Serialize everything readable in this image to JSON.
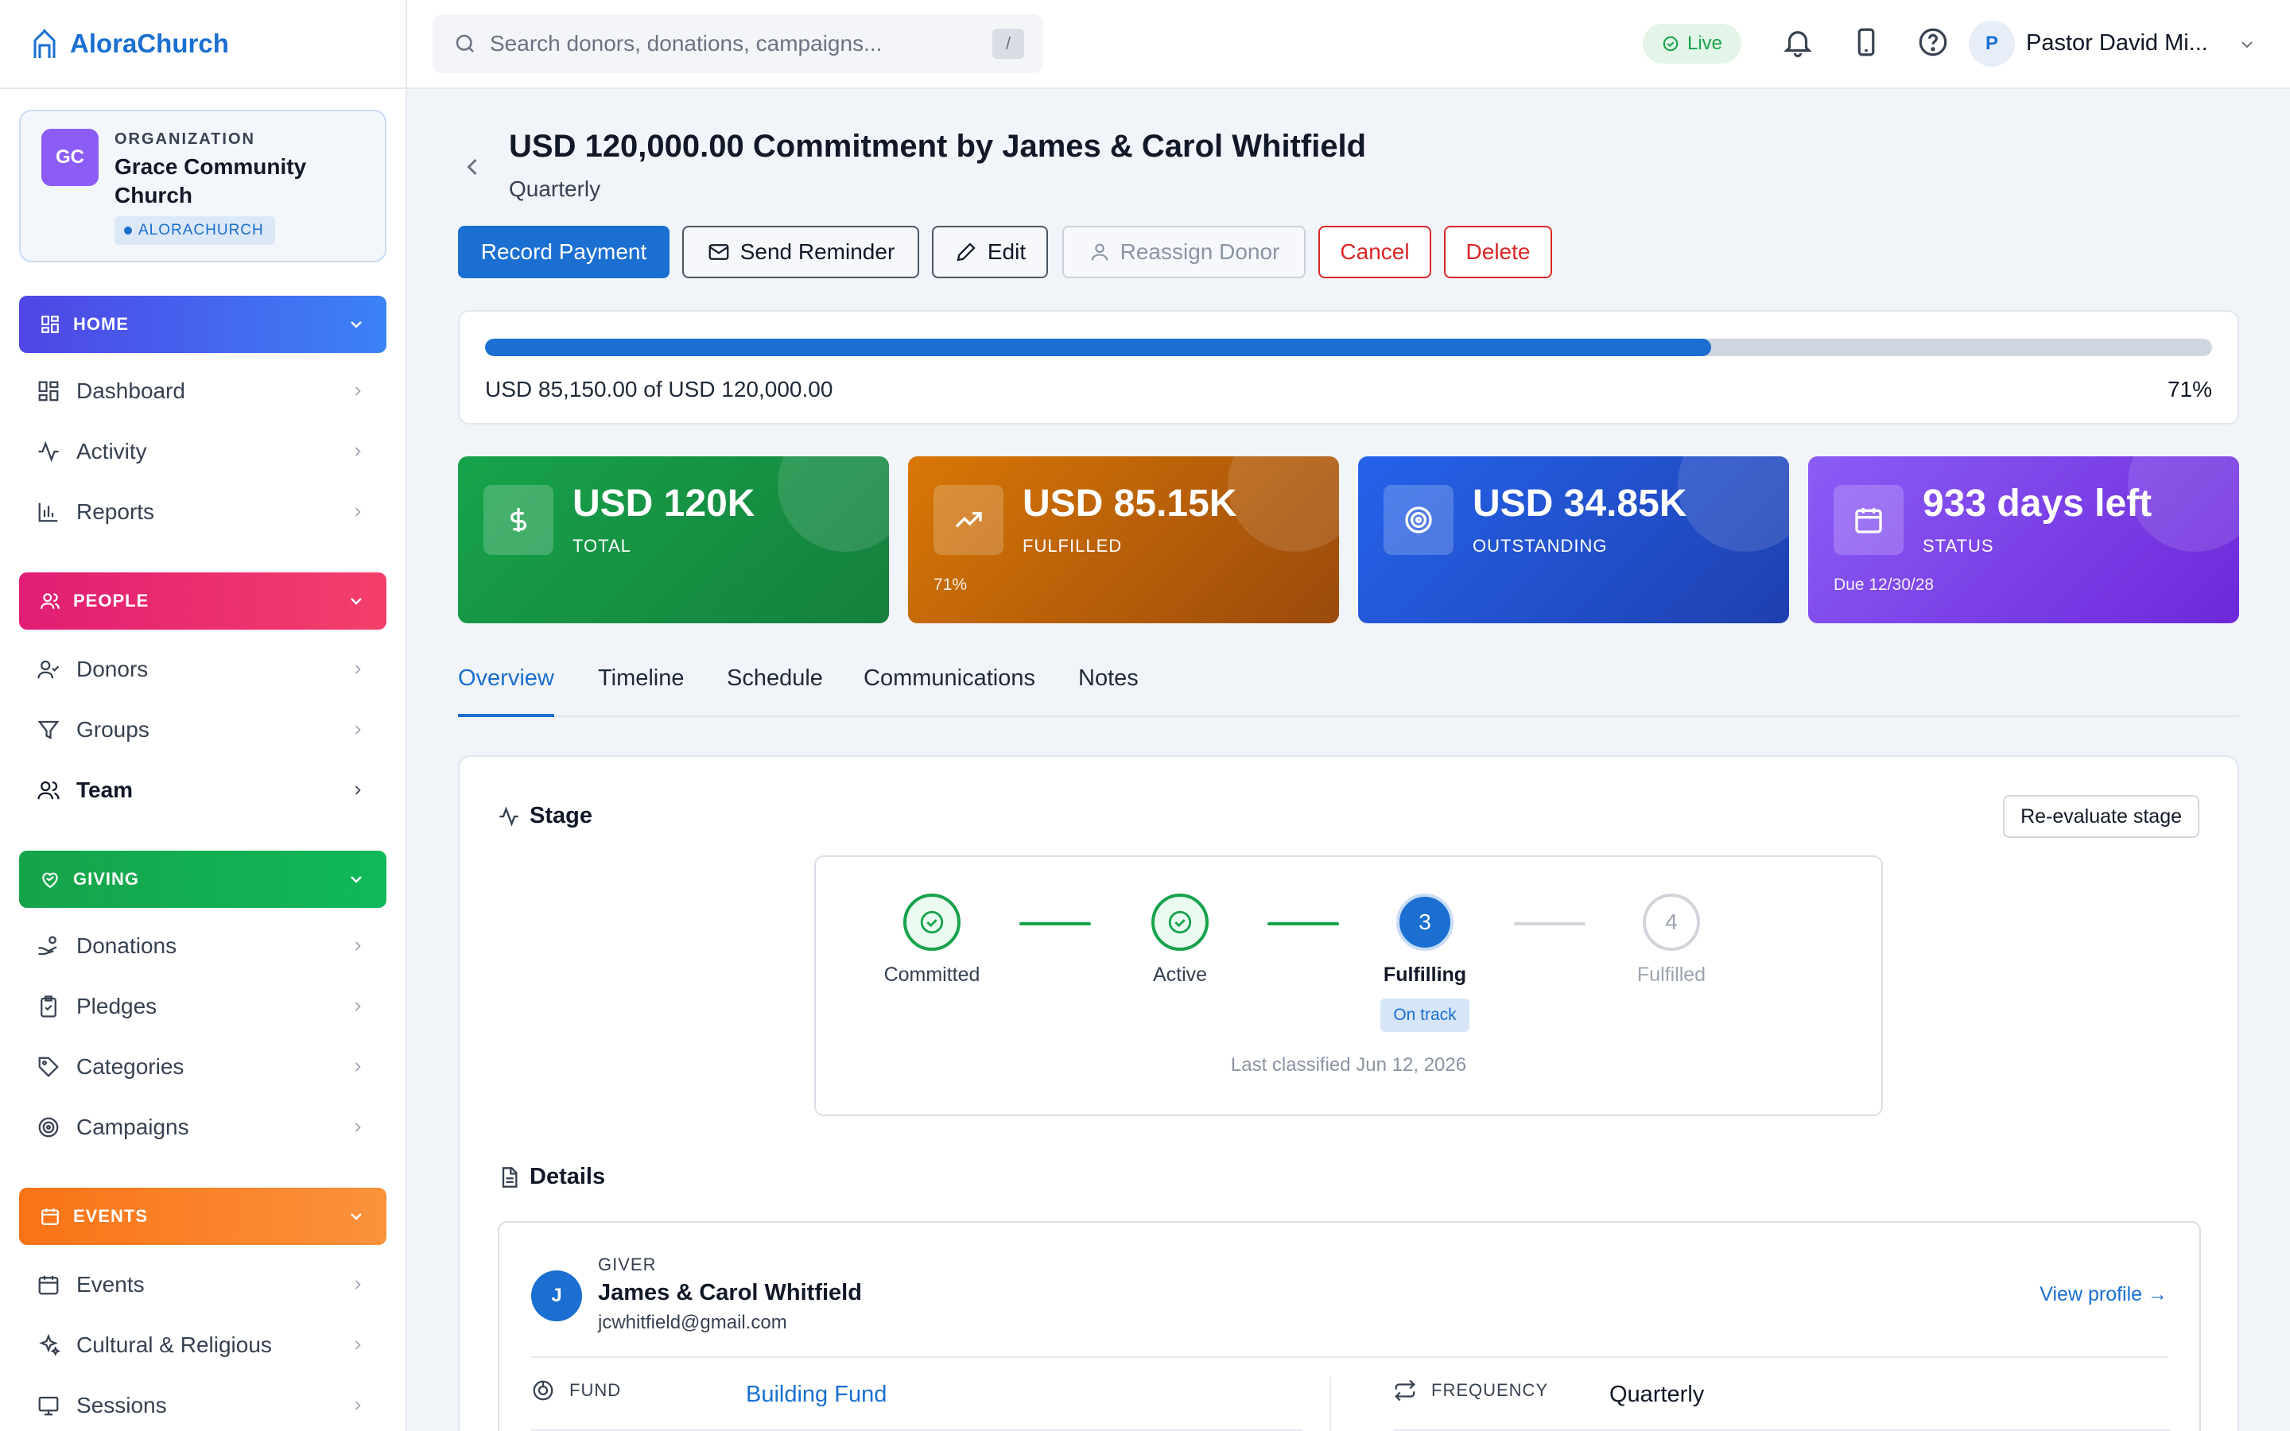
{
  "app": {
    "brand": "AloraChurch"
  },
  "org": {
    "label": "ORGANIZATION",
    "name": "Grace Community Church",
    "initials": "GC",
    "tag": "ALORACHURCH"
  },
  "sidebar": {
    "sections": [
      {
        "label": "HOME",
        "items": [
          "Dashboard",
          "Activity",
          "Reports"
        ]
      },
      {
        "label": "PEOPLE",
        "items": [
          "Donors",
          "Groups",
          "Team"
        ]
      },
      {
        "label": "GIVING",
        "items": [
          "Donations",
          "Pledges",
          "Categories",
          "Campaigns"
        ]
      },
      {
        "label": "EVENTS",
        "items": [
          "Events",
          "Cultural & Religious",
          "Sessions"
        ]
      }
    ],
    "active_item": "Team",
    "colors": {
      "home": "#4f46e5",
      "people": "#e11d74",
      "giving": "#16a34a",
      "events": "#f97316"
    }
  },
  "topbar": {
    "search_placeholder": "Search donors, donations, campaigns...",
    "search_shortcut": "/",
    "live_label": "Live",
    "user_initial": "P",
    "user_name": "Pastor David Mi..."
  },
  "page": {
    "title": "USD 120,000.00 Commitment by James & Carol Whitfield",
    "subtitle": "Quarterly",
    "actions": {
      "record_payment": "Record Payment",
      "send_reminder": "Send Reminder",
      "edit": "Edit",
      "reassign_donor": "Reassign Donor",
      "cancel": "Cancel",
      "delete": "Delete"
    }
  },
  "progress": {
    "text": "USD 85,150.00 of USD 120,000.00",
    "percent_label": "71%",
    "fraction": 0.71
  },
  "stats": [
    {
      "value": "USD 120K",
      "label": "TOTAL",
      "sub": "",
      "icon": "dollar-icon",
      "color": "#15803d"
    },
    {
      "value": "USD 85.15K",
      "label": "FULFILLED",
      "sub": "71%",
      "icon": "trending-up-icon",
      "color": "#c2410c"
    },
    {
      "value": "USD 34.85K",
      "label": "OUTSTANDING",
      "sub": "",
      "icon": "target-icon",
      "color": "#1d4ed8"
    },
    {
      "value": "933 days left",
      "label": "STATUS",
      "sub": "Due 12/30/28",
      "icon": "calendar-icon",
      "color": "#7c3aed"
    }
  ],
  "tabs": [
    "Overview",
    "Timeline",
    "Schedule",
    "Communications",
    "Notes"
  ],
  "active_tab": "Overview",
  "stage": {
    "heading": "Stage",
    "reevaluate": "Re-evaluate stage",
    "steps": [
      {
        "num": "1",
        "label": "Committed",
        "state": "done"
      },
      {
        "num": "2",
        "label": "Active",
        "state": "done"
      },
      {
        "num": "3",
        "label": "Fulfilling",
        "state": "current"
      },
      {
        "num": "4",
        "label": "Fulfilled",
        "state": "todo"
      }
    ],
    "badge": "On track",
    "last_classified": "Last classified Jun 12, 2026"
  },
  "details": {
    "heading": "Details",
    "giver_label": "GIVER",
    "giver_initial": "J",
    "giver_name": "James & Carol Whitfield",
    "giver_email": "jcwhitfield@gmail.com",
    "view_profile": "View profile →",
    "fund_label": "FUND",
    "fund_value": "Building Fund",
    "frequency_label": "FREQUENCY",
    "frequency_value": "Quarterly"
  }
}
